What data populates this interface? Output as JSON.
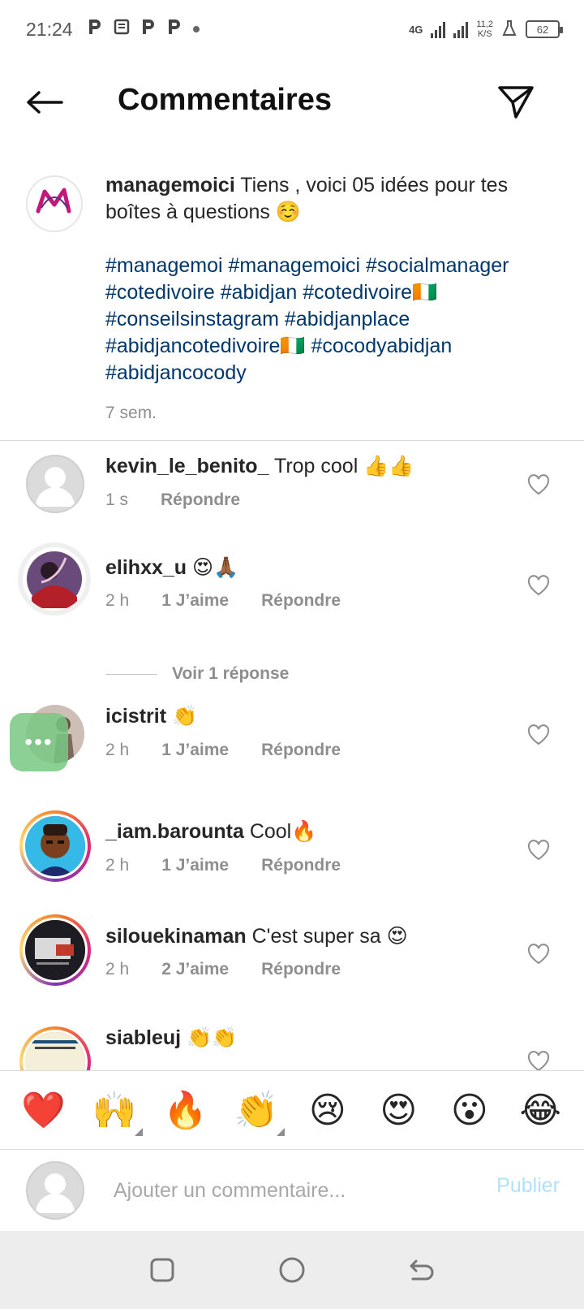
{
  "status_bar": {
    "time": "21:24",
    "network": "4G",
    "speed_top": "11,2",
    "speed_bottom": "K/S",
    "battery": "62"
  },
  "header": {
    "title": "Commentaires"
  },
  "caption": {
    "username": "managemoici",
    "text": " Tiens , voici 05 idées pour tes boîtes à questions ☺️",
    "hashtags": "#managemoi #managemoici #socialmanager #cotedivoire #abidjan #cotedivoire🇨🇮 #conseilsinstagram #abidjanplace #abidjancotedivoire🇨🇮 #cocodyabidjan #abidjancocody",
    "time": "7 sem.",
    "avatar_text": "MANAGE-MOI"
  },
  "comments": [
    {
      "username": "kevin_le_benito_",
      "text": " Trop cool 👍👍",
      "time": "1 s",
      "likes": "",
      "reply": "Répondre"
    },
    {
      "username": "elihxx_u",
      "text": " 😍🙏🏾",
      "time": "2 h",
      "likes": "1 J’aime",
      "reply": "Répondre"
    },
    {
      "username": "icistrit",
      "text": " 👏",
      "time": "2 h",
      "likes": "1 J’aime",
      "reply": "Répondre"
    },
    {
      "username": "_iam.barounta",
      "text": " Cool🔥",
      "time": "2 h",
      "likes": "1 J’aime",
      "reply": "Répondre"
    },
    {
      "username": "silouekinaman",
      "text": " C'est super sa 😍",
      "time": "2 h",
      "likes": "2 J’aime",
      "reply": "Répondre"
    },
    {
      "username": "siableuj",
      "text": " 👏👏",
      "time": "",
      "likes": "",
      "reply": ""
    }
  ],
  "view_replies": "Voir 1 réponse",
  "floating_bubble": "•••",
  "emoji_bar": [
    "❤️",
    "🙌",
    "🔥",
    "👏",
    "😢",
    "😍",
    "😮",
    "😂"
  ],
  "composer": {
    "placeholder": "Ajouter un commentaire...",
    "publish_label": "Publier"
  },
  "colors": {
    "hashtag": "#00376b",
    "secondary_text": "#8e8e8e",
    "publish_disabled": "#b2dffc"
  }
}
